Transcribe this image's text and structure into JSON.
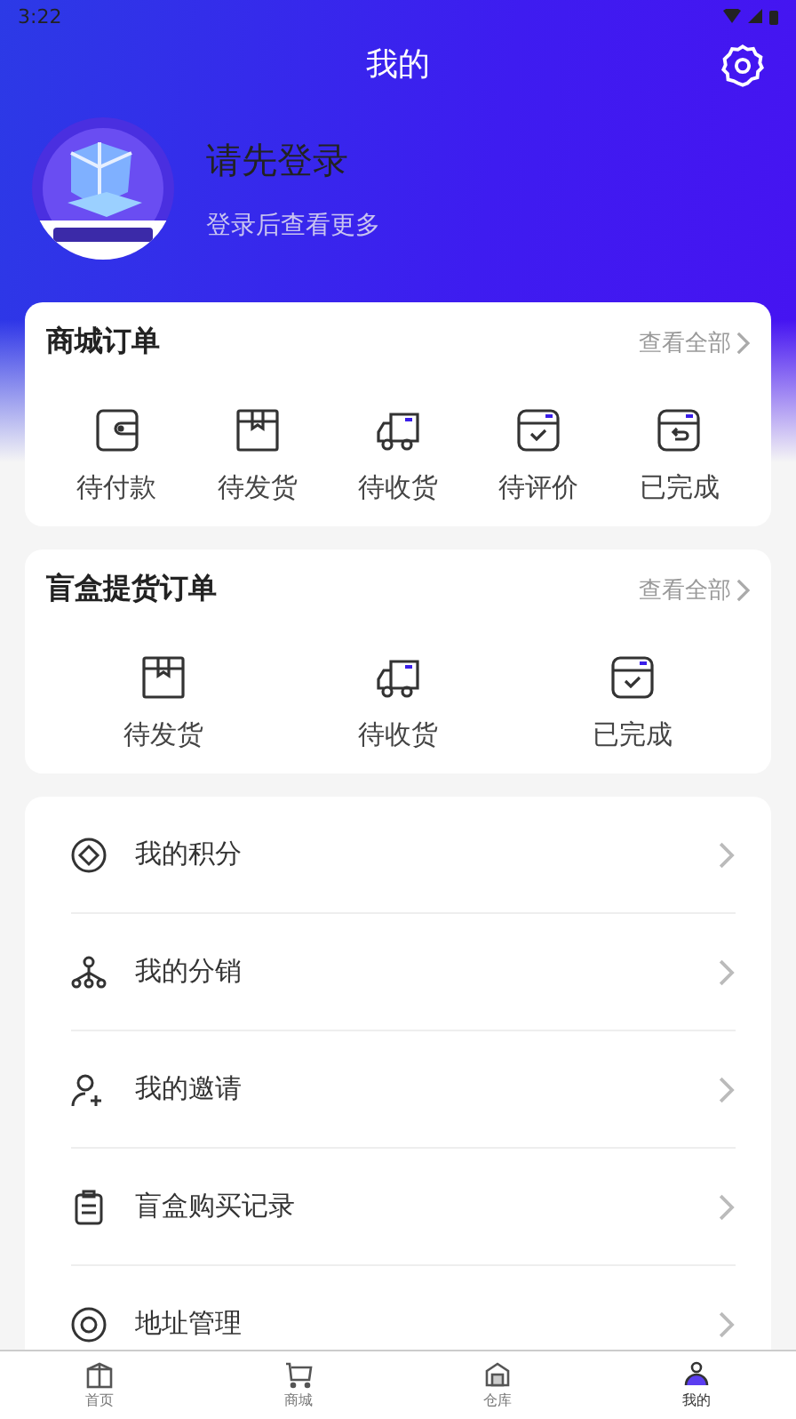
{
  "status_bar": {
    "time": "3:22"
  },
  "header": {
    "title": "我的"
  },
  "profile": {
    "name": "请先登录",
    "subtitle": "登录后查看更多"
  },
  "order_sections": [
    {
      "title": "商城订单",
      "more": "查看全部",
      "items": [
        {
          "kind": "wallet",
          "label": "待付款"
        },
        {
          "kind": "box",
          "label": "待发货"
        },
        {
          "kind": "truck",
          "label": "待收货"
        },
        {
          "kind": "check",
          "label": "待评价"
        },
        {
          "kind": "return",
          "label": "已完成"
        }
      ]
    },
    {
      "title": "盲盒提货订单",
      "more": "查看全部",
      "items": [
        {
          "kind": "box",
          "label": "待发货"
        },
        {
          "kind": "truck",
          "label": "待收货"
        },
        {
          "kind": "check",
          "label": "已完成"
        }
      ]
    }
  ],
  "menu": [
    {
      "kind": "points",
      "label": "我的积分"
    },
    {
      "kind": "network",
      "label": "我的分销"
    },
    {
      "kind": "invite",
      "label": "我的邀请"
    },
    {
      "kind": "record",
      "label": "盲盒购买记录"
    },
    {
      "kind": "address",
      "label": "地址管理"
    }
  ],
  "tab_bar": [
    {
      "kind": "home",
      "label": "首页",
      "selected": false
    },
    {
      "kind": "cart",
      "label": "商城",
      "selected": false
    },
    {
      "kind": "store",
      "label": "仓库",
      "selected": false
    },
    {
      "kind": "user",
      "label": "我的",
      "selected": true
    }
  ]
}
